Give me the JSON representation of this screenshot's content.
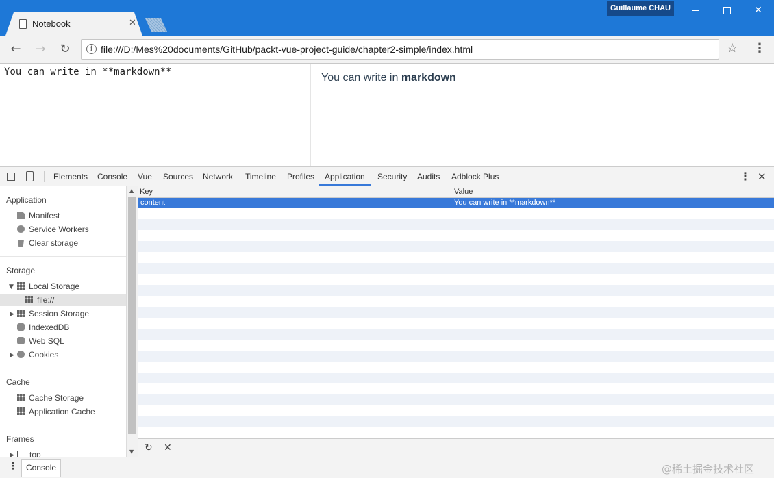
{
  "window": {
    "user_badge": "Guillaume CHAU",
    "tab_title": "Notebook",
    "close_glyph": "✕"
  },
  "toolbar": {
    "url": "file:///D:/Mes%20documents/GitHub/packt-vue-project-guide/chapter2-simple/index.html",
    "back_glyph": "←",
    "forward_glyph": "→",
    "reload_glyph": "↻",
    "star_glyph": "☆",
    "menu_glyph": "⋮",
    "info_glyph": "i"
  },
  "page": {
    "editor_text": "You can write in **markdown**",
    "preview_prefix": "You can write in ",
    "preview_bold": "markdown"
  },
  "devtools": {
    "tabs": [
      "Elements",
      "Console",
      "Vue",
      "Sources",
      "Network",
      "Timeline",
      "Profiles",
      "Application",
      "Security",
      "Audits",
      "Adblock Plus"
    ],
    "active_tab": "Application",
    "sidebar": {
      "sections": [
        "Application",
        "Storage",
        "Cache",
        "Frames"
      ],
      "application_items": [
        "Manifest",
        "Service Workers",
        "Clear storage"
      ],
      "storage_items": [
        "Local Storage",
        "file://",
        "Session Storage",
        "IndexedDB",
        "Web SQL",
        "Cookies"
      ],
      "cache_items": [
        "Cache Storage",
        "Application Cache"
      ],
      "frames_items": [
        "top"
      ]
    },
    "table": {
      "headers": [
        "Key",
        "Value"
      ],
      "rows": [
        {
          "key": "content",
          "value": "You can write in **markdown**"
        }
      ]
    },
    "drawer_tab": "Console",
    "watermark": "@稀土掘金技术社区"
  }
}
